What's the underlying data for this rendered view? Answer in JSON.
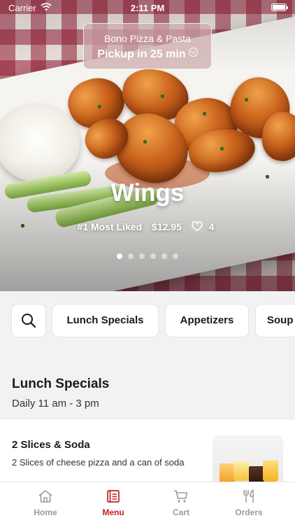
{
  "status_bar": {
    "carrier": "Carrier",
    "time": "2:11 PM"
  },
  "store": {
    "name": "Bono Pizza & Pasta",
    "pickup": "Pickup in 25 min"
  },
  "featured": {
    "title": "Wings",
    "rank": "#1 Most Liked",
    "price": "$12.95",
    "likes": "4",
    "carousel_count": 6,
    "carousel_active": 1
  },
  "categories": [
    "Lunch Specials",
    "Appetizers",
    "Soup"
  ],
  "section": {
    "title": "Lunch Specials",
    "subtitle": "Daily 11 am - 3 pm"
  },
  "items": [
    {
      "name": "2 Slices & Soda",
      "description": "2 Slices of cheese pizza and a can of soda"
    }
  ],
  "tabs": [
    {
      "label": "Home",
      "icon": "home-icon"
    },
    {
      "label": "Menu",
      "icon": "menu-icon"
    },
    {
      "label": "Cart",
      "icon": "cart-icon"
    },
    {
      "label": "Orders",
      "icon": "fork-knife-icon"
    }
  ],
  "colors": {
    "accent": "#c21f24",
    "inactive": "#9b9b9b"
  }
}
